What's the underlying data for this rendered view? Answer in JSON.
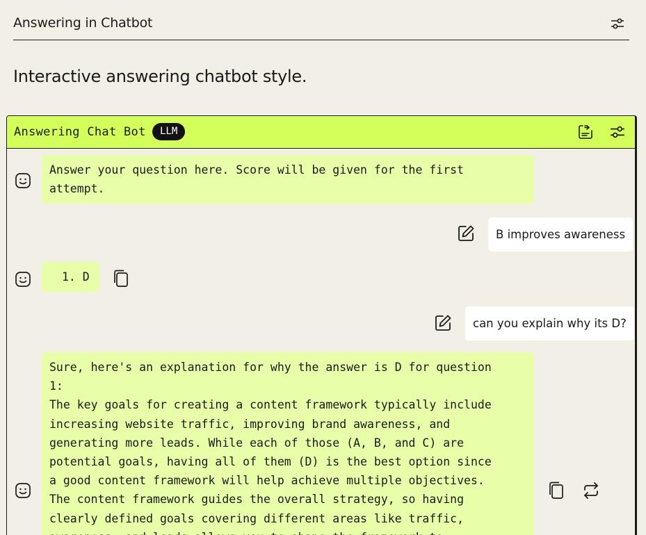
{
  "page": {
    "title": "Answering in Chatbot",
    "subtitle": "Interactive answering chatbot style."
  },
  "chat": {
    "title": "Answering Chat Bot",
    "badge": "LLM",
    "messages": [
      {
        "role": "bot",
        "text": "Answer your question here. Score will be given for the first\nattempt."
      },
      {
        "role": "user",
        "text": "B improves awareness"
      },
      {
        "role": "bot",
        "text": "1. D"
      },
      {
        "role": "user",
        "text": "can you explain why its D?"
      },
      {
        "role": "bot",
        "text": "Sure, here's an explanation for why the answer is D for question\n1:\nThe key goals for creating a content framework typically include\nincreasing website traffic, improving brand awareness, and\ngenerating more leads. While each of those (A, B, and C) are\npotential goals, having all of them (D) is the best option since\na good content framework will help achieve multiple objectives.\nThe content framework guides the overall strategy, so having\nclearly defined goals covering different areas like traffic,\nawareness, and leads allows you to shape the framework to"
      }
    ]
  },
  "icons": {
    "page_settings": "sliders-icon",
    "export": "export-icon",
    "chat_settings": "sliders-icon",
    "bot_avatar": "smiley-icon",
    "edit": "edit-icon",
    "copy": "copy-icon",
    "regenerate": "regenerate-icon"
  },
  "colors": {
    "background": "#f2efe6",
    "accent": "#d4ff5a",
    "bot_bubble": "#e8ffaa",
    "user_bubble": "#ffffff",
    "badge": "#121212"
  }
}
